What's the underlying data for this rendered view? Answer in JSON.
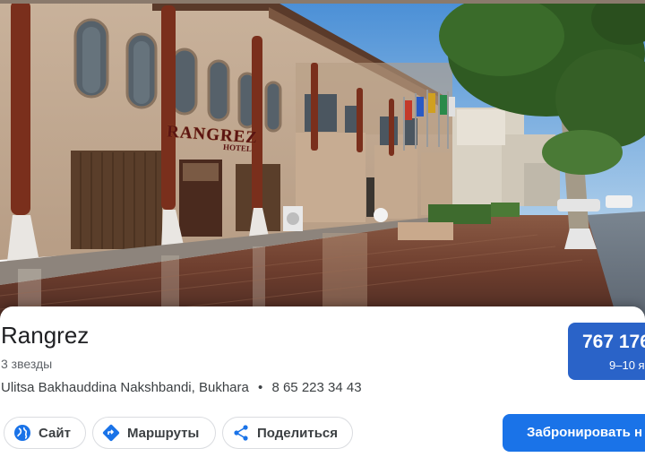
{
  "hotel": {
    "name": "Rangrez",
    "rating": "3 звезды",
    "address": "Ulitsa Bakhauddina Nakshbandi, Bukhara",
    "separator": "•",
    "phone": "8 65 223 34 43",
    "sign_text": "RANGREZ",
    "sign_sub": "HOTEL"
  },
  "price": {
    "value": "767 176",
    "dates": "9–10 я"
  },
  "actions": {
    "website_label": "Сайт",
    "directions_label": "Маршруты",
    "share_label": "Поделиться",
    "book_label": "Забронировать н"
  },
  "colors": {
    "accent": "#1a73e8",
    "price_bg": "#2a63c8"
  },
  "icons": {
    "website": "globe-icon",
    "directions": "directions-icon",
    "share": "share-icon"
  }
}
